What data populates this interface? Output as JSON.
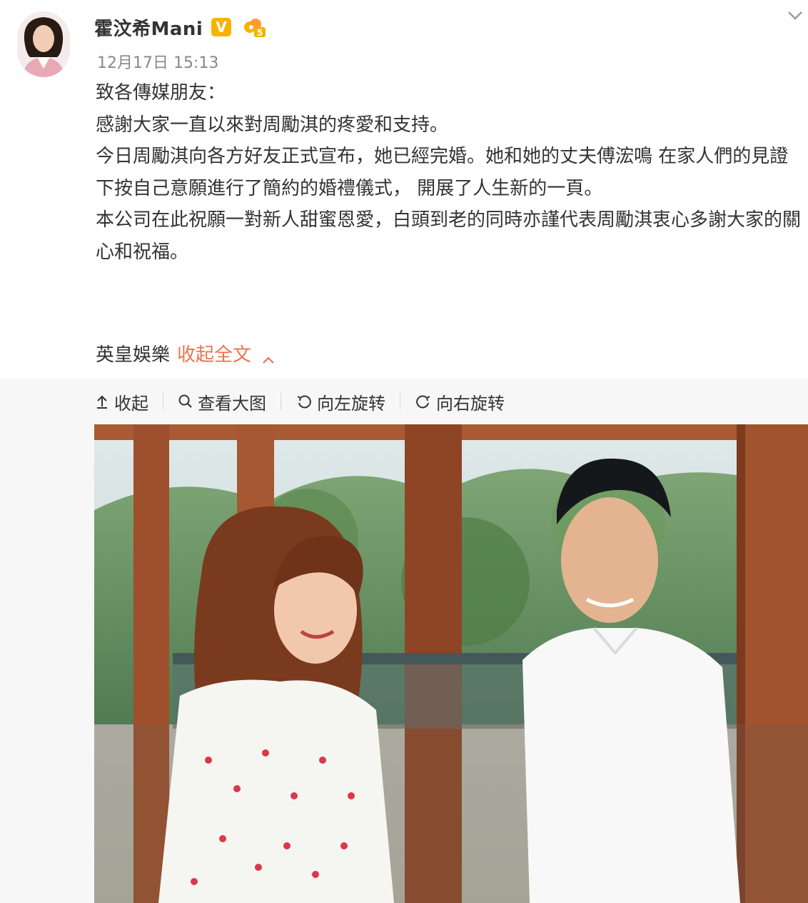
{
  "post": {
    "user_name": "霍汶希Mani",
    "verified_badge": "V",
    "level_badge": "5",
    "timestamp": "12月17日 15:13",
    "paragraphs": [
      "致各傳媒朋友：",
      "",
      "感謝大家一直以來對周勵淇的疼愛和支持。",
      "今日周勵淇向各方好友正式宣布，她已經完婚。她和她的丈夫傅浤鳴 在家人們的見證下按自己意願進行了簡約的婚禮儀式， 開展了人生新的一頁。",
      "本公司在此祝願一對新人甜蜜恩愛，白頭到老的同時亦謹代表周勵淇衷心多謝大家的關心和祝福。",
      ""
    ],
    "signature": "英皇娛樂",
    "collapse_label": "收起全文"
  },
  "toolbar": {
    "collapse": "收起",
    "view_large": "查看大图",
    "rotate_left": "向左旋转",
    "rotate_right": "向右旋转"
  },
  "colors": {
    "link": "#eb7350",
    "verified": "#f7b200",
    "text": "#333333",
    "muted": "#888888"
  },
  "icons": {
    "collapse": "arrow-up-icon",
    "view_large": "search-icon",
    "rotate_left": "rotate-left-icon",
    "rotate_right": "rotate-right-icon",
    "menu": "chevron-down-icon"
  }
}
